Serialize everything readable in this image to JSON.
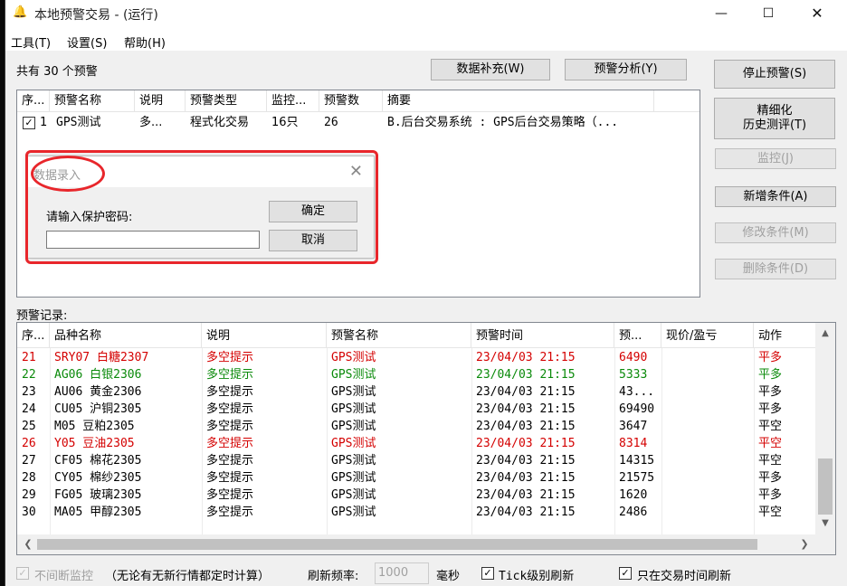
{
  "window": {
    "title": "本地预警交易 - (运行)",
    "min_glyph": "—",
    "max_glyph": "☐",
    "close_glyph": "✕"
  },
  "menu": [
    "工具(T)",
    "设置(S)",
    "帮助(H)"
  ],
  "summary": {
    "count_label": "共有 30 个预警"
  },
  "buttons": {
    "supplement": "数据补充(W)",
    "analysis": "预警分析(Y)",
    "stop": "停止预警(S)",
    "refine_line1": "精细化",
    "refine_line2": "历史测评(T)",
    "monitor": "监控(J)",
    "add": "新增条件(A)",
    "edit": "修改条件(M)",
    "delete": "删除条件(D)"
  },
  "alerts": {
    "columns": [
      "序...",
      "预警名称",
      "说明",
      "预警类型",
      "监控...",
      "预警数",
      "摘要"
    ],
    "rows": [
      {
        "checked": "✓",
        "seq": "1",
        "name": "GPS测试",
        "desc": "多...",
        "type": "程式化交易",
        "monitor": "16只",
        "count": "26",
        "summary": "B.后台交易系统 : GPS后台交易策略（..."
      }
    ]
  },
  "dialog": {
    "title": "数据录入",
    "close_glyph": "✕",
    "label": "请输入保护密码:",
    "ok": "确定",
    "cancel": "取消",
    "password_value": ""
  },
  "records": {
    "label": "预警记录:",
    "columns": [
      "序...",
      "品种名称",
      "说明",
      "预警名称",
      "预警时间",
      "预...",
      "现价/盈亏",
      "动作"
    ],
    "rows": [
      {
        "seq": "21",
        "product": "SRY07 白糖2307",
        "desc": "多空提示",
        "alert": "GPS测试",
        "time": "23/04/03 21:15",
        "price": "6490",
        "pnl": "",
        "action": "平多",
        "color": "#d40000"
      },
      {
        "seq": "22",
        "product": "AG06 白银2306",
        "desc": "多空提示",
        "alert": "GPS测试",
        "time": "23/04/03 21:15",
        "price": "5333",
        "pnl": "",
        "action": "平多",
        "color": "#0a8a0a"
      },
      {
        "seq": "23",
        "product": "AU06 黄金2306",
        "desc": "多空提示",
        "alert": "GPS测试",
        "time": "23/04/03 21:15",
        "price": "43...",
        "pnl": "",
        "action": "平多",
        "color": "#000000"
      },
      {
        "seq": "24",
        "product": "CU05 沪铜2305",
        "desc": "多空提示",
        "alert": "GPS测试",
        "time": "23/04/03 21:15",
        "price": "69490",
        "pnl": "",
        "action": "平多",
        "color": "#000000"
      },
      {
        "seq": "25",
        "product": "M05 豆粕2305",
        "desc": "多空提示",
        "alert": "GPS测试",
        "time": "23/04/03 21:15",
        "price": "3647",
        "pnl": "",
        "action": "平空",
        "color": "#000000"
      },
      {
        "seq": "26",
        "product": "Y05 豆油2305",
        "desc": "多空提示",
        "alert": "GPS测试",
        "time": "23/04/03 21:15",
        "price": "8314",
        "pnl": "",
        "action": "平空",
        "color": "#d40000"
      },
      {
        "seq": "27",
        "product": "CF05 棉花2305",
        "desc": "多空提示",
        "alert": "GPS测试",
        "time": "23/04/03 21:15",
        "price": "14315",
        "pnl": "",
        "action": "平空",
        "color": "#000000"
      },
      {
        "seq": "28",
        "product": "CY05 棉纱2305",
        "desc": "多空提示",
        "alert": "GPS测试",
        "time": "23/04/03 21:15",
        "price": "21575",
        "pnl": "",
        "action": "平多",
        "color": "#000000"
      },
      {
        "seq": "29",
        "product": "FG05 玻璃2305",
        "desc": "多空提示",
        "alert": "GPS测试",
        "time": "23/04/03 21:15",
        "price": "1620",
        "pnl": "",
        "action": "平多",
        "color": "#000000"
      },
      {
        "seq": "30",
        "product": "MA05 甲醇2305",
        "desc": "多空提示",
        "alert": "GPS测试",
        "time": "23/04/03 21:15",
        "price": "2486",
        "pnl": "",
        "action": "平空",
        "color": "#000000"
      }
    ]
  },
  "scroll": {
    "up": "▲",
    "down": "▼",
    "left": "❮",
    "right": "❯"
  },
  "footer": {
    "continuous_check": "✓",
    "continuous_label": "不间断监控",
    "continuous_note": "（无论有无新行情都定时计算）",
    "refresh_label": "刷新频率:",
    "refresh_value": "1000",
    "refresh_unit": "毫秒",
    "tick_check": "✓",
    "tick_label": "Tick级别刷新",
    "trading_check": "✓",
    "trading_label": "只在交易时间刷新"
  },
  "colors": {
    "accent_red": "#e8262b",
    "long_red": "#d40000",
    "short_green": "#0a8a0a"
  }
}
